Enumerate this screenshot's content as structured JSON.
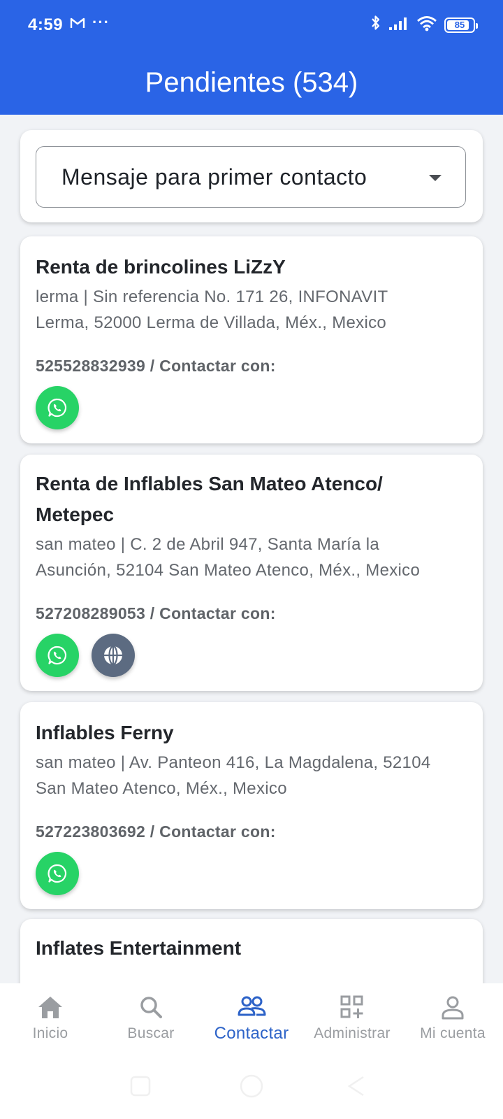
{
  "status": {
    "time": "4:59",
    "more": "···",
    "battery": "85",
    "battery_level": 0.85
  },
  "header": {
    "title": "Pendientes (534)"
  },
  "dropdown": {
    "selected": "Mensaje para primer contacto"
  },
  "listings": [
    {
      "name": "Renta de brincolines LiZzY",
      "address_lines": [
        "lerma | Sin referencia No. 171 26, INFONAVIT",
        "Lerma, 52000 Lerma de Villada, Méx., Mexico"
      ],
      "phone_line": "525528832939 / Contactar con:",
      "contacts": [
        "whatsapp"
      ]
    },
    {
      "name_lines": [
        "Renta de Inflables San Mateo Atenco/",
        "Metepec"
      ],
      "address_lines": [
        "san mateo | C. 2 de Abril 947, Santa María la",
        "Asunción, 52104 San Mateo Atenco, Méx., Mexico"
      ],
      "phone_line": "527208289053 / Contactar con:",
      "contacts": [
        "whatsapp",
        "website"
      ]
    },
    {
      "name": "Inflables Ferny",
      "address_lines": [
        "san mateo | Av. Panteon 416, La Magdalena, 52104",
        "San Mateo Atenco, Méx., Mexico"
      ],
      "phone_line": "527223803692 / Contactar con:",
      "contacts": [
        "whatsapp"
      ]
    },
    {
      "name": "Inflates Entertainment"
    }
  ],
  "nav": {
    "items": [
      {
        "label": "Inicio",
        "icon": "home-icon"
      },
      {
        "label": "Buscar",
        "icon": "search-icon"
      },
      {
        "label": "Contactar",
        "icon": "people-icon",
        "active": true
      },
      {
        "label": "Administrar",
        "icon": "grid-add-icon"
      },
      {
        "label": "Mi cuenta",
        "icon": "person-icon"
      }
    ]
  },
  "colors": {
    "primary": "#2a64e6",
    "whatsapp": "#27d366",
    "web": "#5c6b81",
    "active_nav": "#2d63c8",
    "inactive_nav": "#9a9da1"
  }
}
